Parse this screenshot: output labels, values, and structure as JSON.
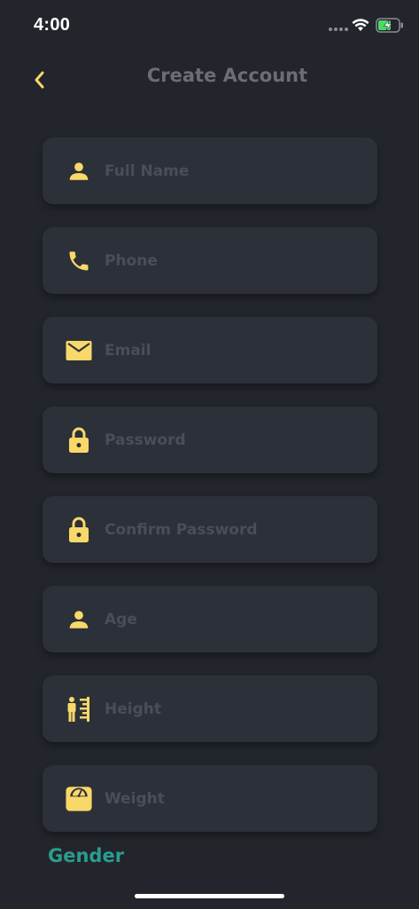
{
  "status_bar": {
    "time": "4:00"
  },
  "header": {
    "title": "Create Account",
    "back_icon": "chevron-left-icon"
  },
  "colors": {
    "background": "#22252b",
    "field_background": "#2c3038",
    "accent_yellow": "#f9d86a",
    "title_gray": "#6b6e74",
    "placeholder_gray": "#4a4e56",
    "gender_teal": "#2a9d8f",
    "battery_green": "#4cd964"
  },
  "form": {
    "fields": [
      {
        "placeholder": "Full Name",
        "icon": "person-icon",
        "value": ""
      },
      {
        "placeholder": "Phone",
        "icon": "phone-icon",
        "value": ""
      },
      {
        "placeholder": "Email",
        "icon": "mail-icon",
        "value": ""
      },
      {
        "placeholder": "Password",
        "icon": "lock-icon",
        "value": ""
      },
      {
        "placeholder": "Confirm Password",
        "icon": "lock-icon",
        "value": ""
      },
      {
        "placeholder": "Age",
        "icon": "person-icon",
        "value": ""
      },
      {
        "placeholder": "Height",
        "icon": "height-ruler-icon",
        "value": ""
      },
      {
        "placeholder": "Weight",
        "icon": "weight-scale-icon",
        "value": ""
      }
    ],
    "gender_label": "Gender"
  }
}
